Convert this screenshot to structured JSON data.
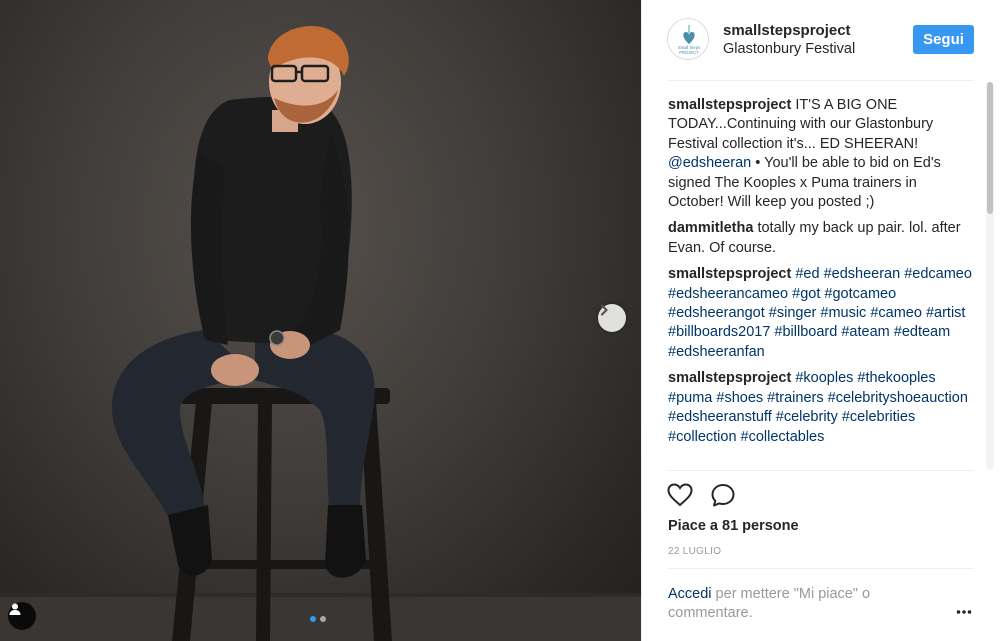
{
  "post": {
    "owner": "smallstepsproject",
    "location": "Glastonbury Festival",
    "follow_label": "Segui",
    "avatar_lines": [
      "Small Steps",
      "PROJECT"
    ],
    "likes_text": "Piace a 81 persone",
    "date_text": "22 LUGLIO",
    "login_link": "Accedi",
    "login_rest": " per mettere \"Mi piace\" o commentare."
  },
  "comments": [
    {
      "user": "smallstepsproject",
      "parts": [
        {
          "text": "IT'S A BIG ONE TODAY...Continuing with our Glastonbury Festival collection it's... ED SHEERAN! "
        },
        {
          "text": "@edsheeran",
          "tag": true
        },
        {
          "text": " • You'll be able to bid on Ed's signed The Kooples x Puma trainers in October! Will keep you posted ;)"
        }
      ]
    },
    {
      "user": "dammitletha",
      "parts": [
        {
          "text": "totally my back up pair. lol. after Evan. Of course."
        }
      ]
    },
    {
      "user": "smallstepsproject",
      "parts": [
        {
          "text": "#ed",
          "tag": true
        },
        {
          "text": " "
        },
        {
          "text": "#edsheeran",
          "tag": true
        },
        {
          "text": " "
        },
        {
          "text": "#edcameo",
          "tag": true
        },
        {
          "text": " "
        },
        {
          "text": "#edsheerancameo",
          "tag": true
        },
        {
          "text": " "
        },
        {
          "text": "#got",
          "tag": true
        },
        {
          "text": " "
        },
        {
          "text": "#gotcameo",
          "tag": true
        },
        {
          "text": " "
        },
        {
          "text": "#edsheerangot",
          "tag": true
        },
        {
          "text": " "
        },
        {
          "text": "#singer",
          "tag": true
        },
        {
          "text": " "
        },
        {
          "text": "#music",
          "tag": true
        },
        {
          "text": " "
        },
        {
          "text": "#cameo",
          "tag": true
        },
        {
          "text": " "
        },
        {
          "text": "#artist",
          "tag": true
        },
        {
          "text": " "
        },
        {
          "text": "#billboards2017",
          "tag": true
        },
        {
          "text": " "
        },
        {
          "text": "#billboard",
          "tag": true
        },
        {
          "text": " "
        },
        {
          "text": "#ateam",
          "tag": true
        },
        {
          "text": " "
        },
        {
          "text": "#edteam",
          "tag": true
        },
        {
          "text": " "
        },
        {
          "text": "#edsheeranfan",
          "tag": true
        }
      ]
    },
    {
      "user": "smallstepsproject",
      "parts": [
        {
          "text": "#kooples",
          "tag": true
        },
        {
          "text": " "
        },
        {
          "text": "#thekooples",
          "tag": true
        },
        {
          "text": " "
        },
        {
          "text": "#puma",
          "tag": true
        },
        {
          "text": " "
        },
        {
          "text": "#shoes",
          "tag": true
        },
        {
          "text": " "
        },
        {
          "text": "#trainers",
          "tag": true
        },
        {
          "text": " "
        },
        {
          "text": "#celebrityshoeauction",
          "tag": true
        },
        {
          "text": " "
        },
        {
          "text": "#edsheeranstuff",
          "tag": true
        },
        {
          "text": " "
        },
        {
          "text": "#celebrity",
          "tag": true
        },
        {
          "text": " "
        },
        {
          "text": "#celebrities",
          "tag": true
        },
        {
          "text": " "
        },
        {
          "text": "#collection",
          "tag": true
        },
        {
          "text": " "
        },
        {
          "text": "#collectables",
          "tag": true
        }
      ]
    }
  ],
  "carousel": {
    "count": 2,
    "active": 0
  },
  "icons": {
    "next": "chevron-right-icon",
    "tag": "user-tag-icon",
    "like": "heart-icon",
    "comment": "comment-bubble-icon",
    "more": "more-options-icon"
  },
  "colors": {
    "accent": "#3897f0",
    "link": "#003569",
    "muted": "#999999",
    "text": "#262626"
  }
}
